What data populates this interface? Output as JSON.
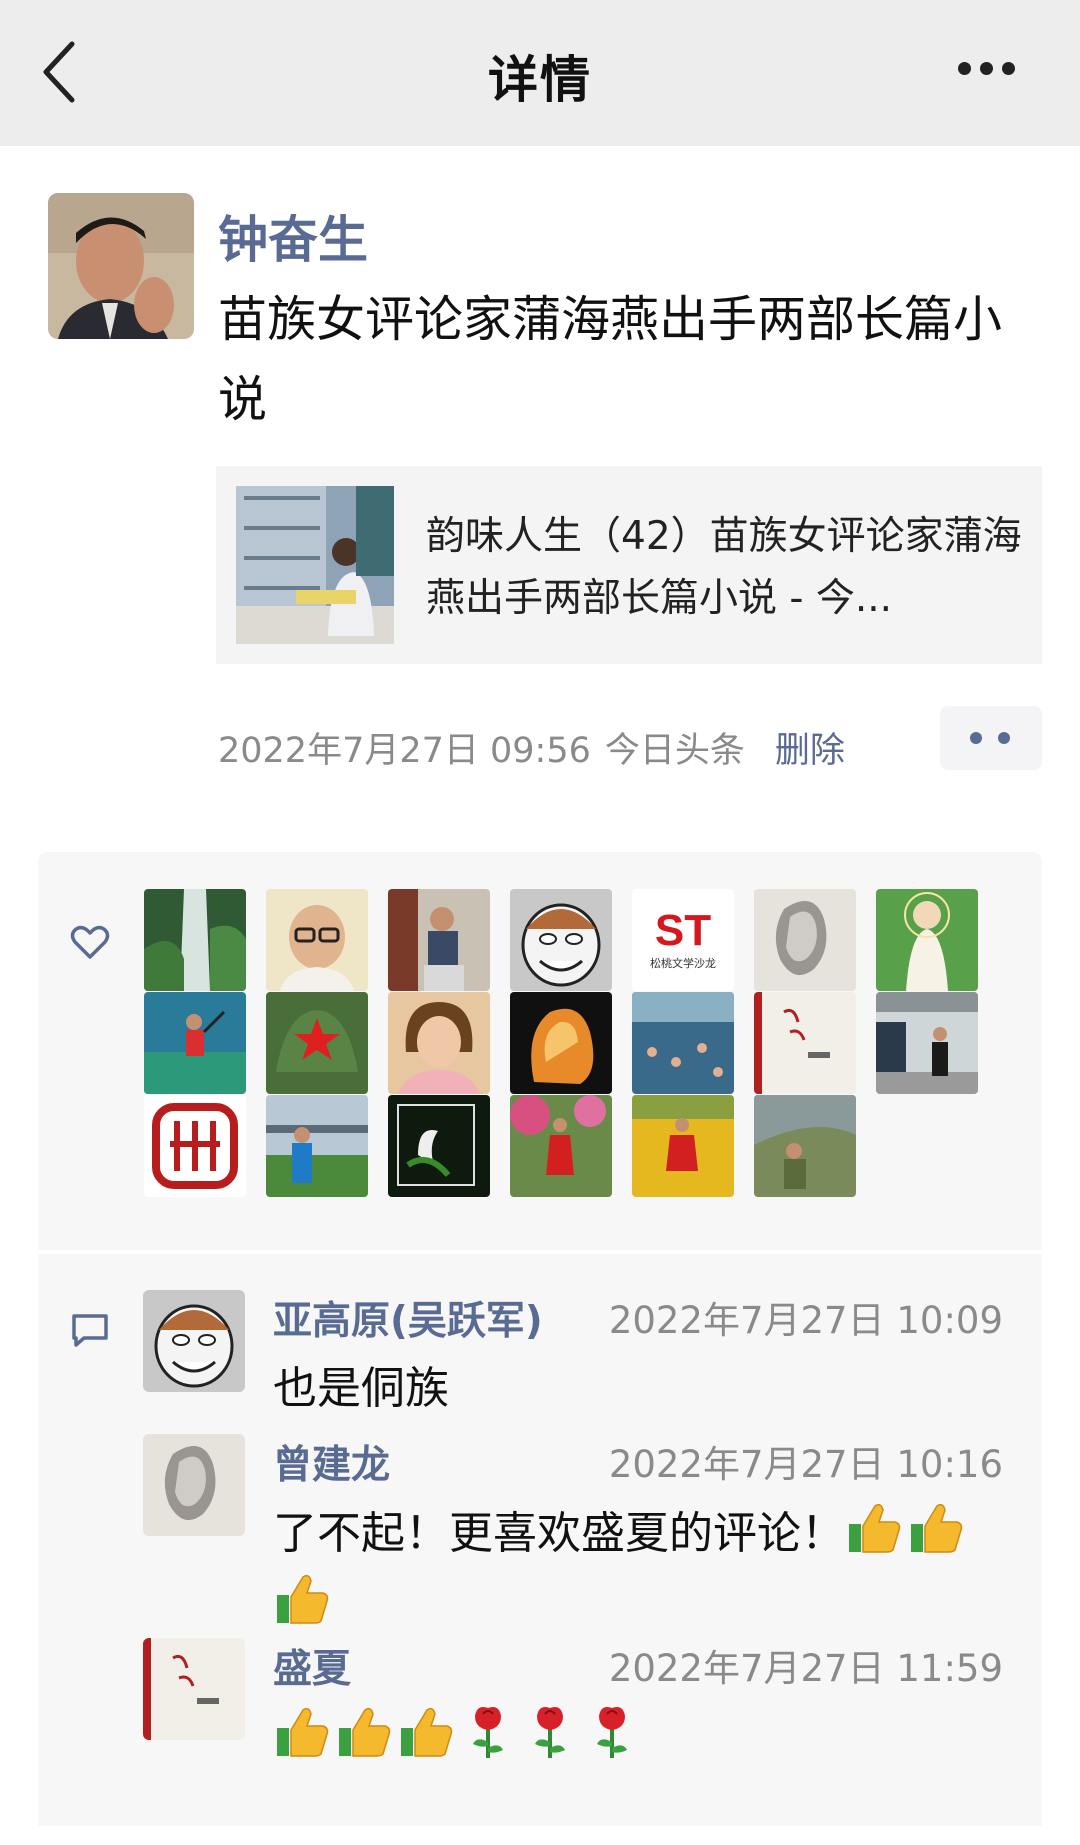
{
  "header": {
    "title": "详情",
    "back_icon": "chevron-left-icon",
    "more_icon": "more-icon"
  },
  "post": {
    "author": "钟奋生",
    "text": "苗族女评论家蒲海燕出手两部长篇小说",
    "share": {
      "title": "韵味人生（42）苗族女评论家蒲海燕出手两部长篇小说 - 今..."
    },
    "time": "2022年7月27日 09:56",
    "source": "今日头条",
    "delete_label": "删除"
  },
  "likes": {
    "icon": "heart-icon",
    "avatars": [
      {
        "name": "waterfall"
      },
      {
        "name": "glasses-man"
      },
      {
        "name": "men-sitting"
      },
      {
        "name": "caricature"
      },
      {
        "name": "st-logo",
        "text": "ST",
        "caption": "松桃文学沙龙"
      },
      {
        "name": "white-stone"
      },
      {
        "name": "guanyin"
      },
      {
        "name": "badminton"
      },
      {
        "name": "red-star-cap"
      },
      {
        "name": "woman-portrait"
      },
      {
        "name": "amber-stone"
      },
      {
        "name": "swimming-pool"
      },
      {
        "name": "book-cover"
      },
      {
        "name": "train-platform"
      },
      {
        "name": "red-seal"
      },
      {
        "name": "bridge-man"
      },
      {
        "name": "white-flower"
      },
      {
        "name": "woman-red-coat"
      },
      {
        "name": "flower-field"
      },
      {
        "name": "man-in-valley"
      }
    ]
  },
  "comments": {
    "icon": "comment-icon",
    "items": [
      {
        "name": "亚高原(吴跃军)",
        "time": "2022年7月27日 10:09",
        "text": "也是侗族",
        "avatar": "caricature"
      },
      {
        "name": "曾建龙",
        "time": "2022年7月27日 10:16",
        "text": "了不起！更喜欢盛夏的评论！",
        "emoji": [
          "thumbs-up",
          "thumbs-up",
          "thumbs-up"
        ],
        "avatar": "white-stone"
      },
      {
        "name": "盛夏",
        "time": "2022年7月27日 11:59",
        "text": "",
        "emoji": [
          "thumbs-up",
          "thumbs-up",
          "thumbs-up",
          "rose",
          "rose",
          "rose"
        ],
        "avatar": "book-cover"
      }
    ]
  },
  "colors": {
    "link": "#5a6b93",
    "meta": "#8a8a8a",
    "topbar": "#ededed",
    "panel": "#f7f7f7"
  }
}
